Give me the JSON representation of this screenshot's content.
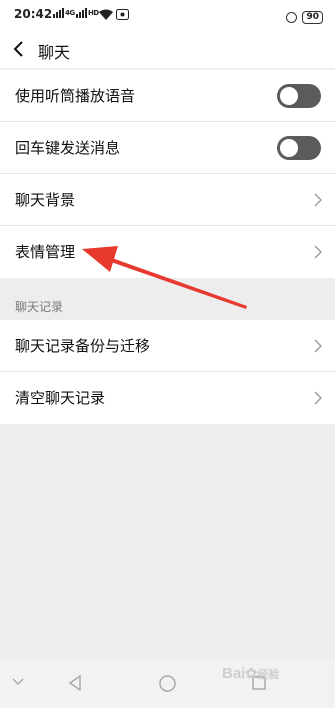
{
  "status_bar": {
    "time": "20:42",
    "sig1": "4G",
    "sig2": "HD",
    "battery": "90"
  },
  "header": {
    "title": "聊天",
    "back_icon": "chevron-left-icon"
  },
  "groups": [
    {
      "items": [
        {
          "label": "使用听筒播放语音",
          "control": "toggle",
          "on": false
        },
        {
          "label": "回车键发送消息",
          "control": "toggle",
          "on": false
        },
        {
          "label": "聊天背景",
          "control": "chevron"
        },
        {
          "label": "表情管理",
          "control": "chevron"
        }
      ]
    },
    {
      "section_title": "聊天记录",
      "items": [
        {
          "label": "聊天记录备份与迁移",
          "control": "chevron"
        },
        {
          "label": "清空聊天记录",
          "control": "chevron"
        }
      ]
    }
  ],
  "annotation": {
    "arrow_color": "#e8392f",
    "points_to": "表情管理"
  },
  "nav_bar": {
    "icons": [
      "chevron-down-icon",
      "back-triangle-icon",
      "home-circle-icon",
      "recents-square-icon"
    ]
  },
  "watermark": {
    "text": "Bai",
    "suffix": "经验"
  }
}
